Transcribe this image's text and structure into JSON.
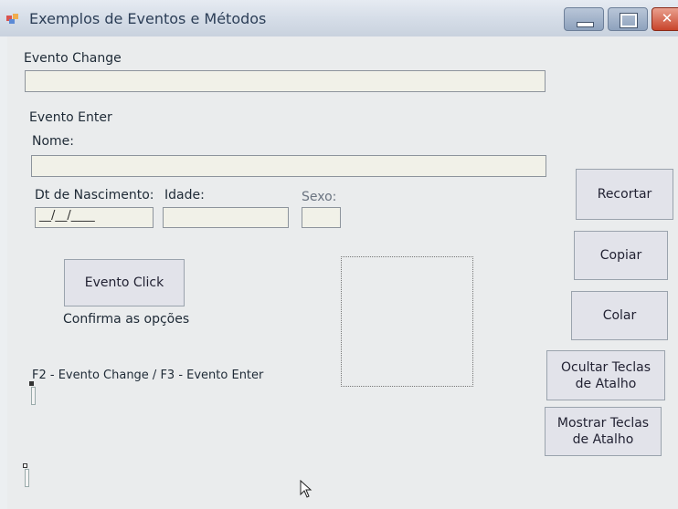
{
  "window": {
    "title": "Exemplos de Eventos e Métodos",
    "buttons": [
      "minimize",
      "maximize",
      "close"
    ],
    "icon": "app-window-icon",
    "close_glyph": "✕"
  },
  "form": {
    "evento_change_label": "Evento Change",
    "evento_change_value": "",
    "evento_enter_label": "Evento Enter",
    "nome_label": "Nome:",
    "nome_value": "",
    "dt_nascimento_label": "Dt de Nascimento:",
    "dt_nascimento_value": "__/__/____",
    "idade_label": "Idade:",
    "idade_value": "",
    "sexo_label": "Sexo:",
    "sexo_value": "",
    "evento_click_button": "Evento Click",
    "confirma_label": "Confirma as opções",
    "shortcut_hint": "F2 - Evento Change / F3 - Evento Enter"
  },
  "side_buttons": {
    "recortar": "Recortar",
    "copiar": "Copiar",
    "colar": "Colar",
    "ocultar": "Ocultar Teclas de Atalho",
    "mostrar": "Mostrar Teclas de Atalho"
  },
  "colors": {
    "window_bg": "#eaeced",
    "textbox_bg": "#f1f1e8",
    "button_bg": "#e2e3ea",
    "close_button": "#c8442b"
  }
}
